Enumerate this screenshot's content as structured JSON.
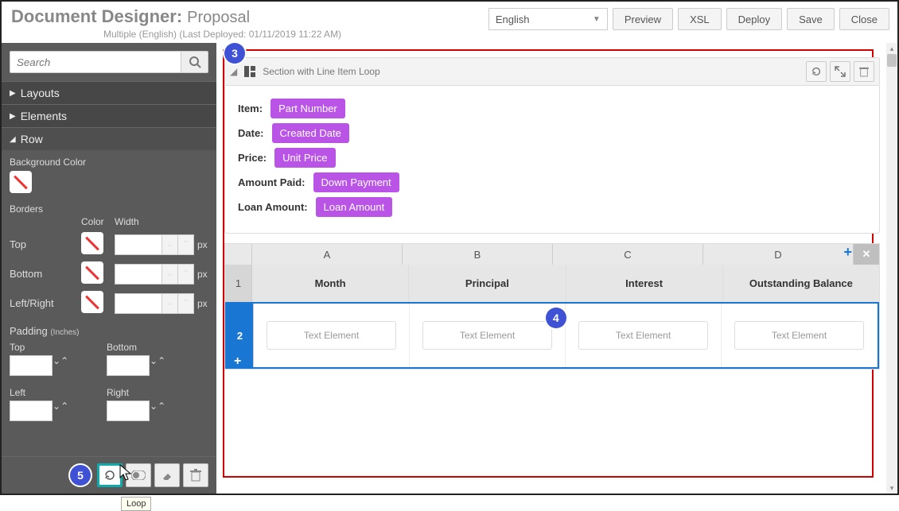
{
  "header": {
    "title_main": "Document Designer:",
    "title_sub": "Proposal",
    "subtitle": "Multiple (English)  (Last Deployed: 01/11/2019 11:22 AM)",
    "language": "English",
    "buttons": {
      "preview": "Preview",
      "xsl": "XSL",
      "deploy": "Deploy",
      "save": "Save",
      "close": "Close"
    }
  },
  "sidebar": {
    "search_placeholder": "Search",
    "sections": {
      "layouts": "Layouts",
      "elements": "Elements",
      "row": "Row"
    },
    "row_panel": {
      "bg_label": "Background Color",
      "borders_label": "Borders",
      "color_label": "Color",
      "width_label": "Width",
      "sides": {
        "top": "Top",
        "bottom": "Bottom",
        "leftright": "Left/Right"
      },
      "unit": "px",
      "padding_label": "Padding",
      "padding_unit": "(Inches)",
      "pad": {
        "top": "Top",
        "bottom": "Bottom",
        "left": "Left",
        "right": "Right"
      }
    },
    "tooltip": "Loop"
  },
  "canvas": {
    "section_title": "Section with Line Item Loop",
    "props": [
      {
        "label": "Item:",
        "chip": "Part Number"
      },
      {
        "label": "Date:",
        "chip": "Created Date"
      },
      {
        "label": "Price:",
        "chip": "Unit Price"
      },
      {
        "label": "Amount Paid:",
        "chip": "Down Payment"
      },
      {
        "label": "Loan Amount:",
        "chip": "Loan Amount"
      }
    ],
    "grid": {
      "cols": [
        "A",
        "B",
        "C",
        "D"
      ],
      "row1": [
        "Month",
        "Principal",
        "Interest",
        "Outstanding Balance"
      ],
      "row2_placeholder": "Text Element",
      "row_nums": [
        "1",
        "2"
      ]
    }
  },
  "callouts": {
    "c3": "3",
    "c4": "4",
    "c5": "5"
  }
}
